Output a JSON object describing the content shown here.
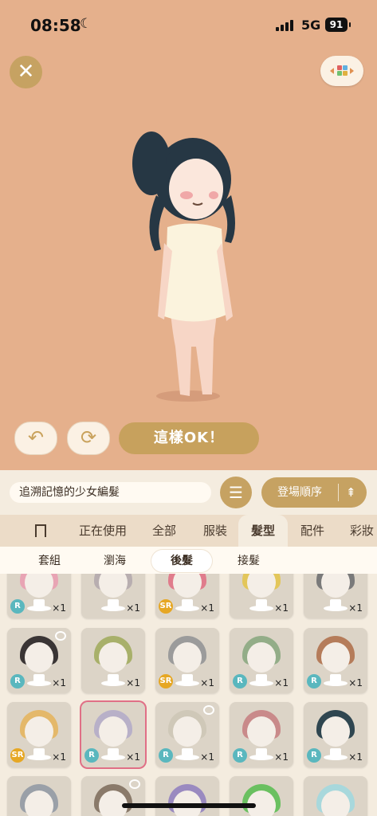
{
  "status": {
    "time": "08:58",
    "network": "5G",
    "battery": "91"
  },
  "toolbar": {
    "ok_label": "這樣OK！"
  },
  "item_name": "追溯記憶的少女編髮",
  "sort": {
    "label": "登場順序"
  },
  "tabs": [
    {
      "label": "正在使用"
    },
    {
      "label": "全部"
    },
    {
      "label": "服裝"
    },
    {
      "label": "髮型"
    },
    {
      "label": "配件"
    },
    {
      "label": "彩妝"
    }
  ],
  "subtabs": [
    {
      "label": "套組"
    },
    {
      "label": "瀏海"
    },
    {
      "label": "後髮"
    },
    {
      "label": "接髮"
    }
  ],
  "items": [
    {
      "rarity": "R",
      "count": "×1",
      "hair": "#e8a4b4"
    },
    {
      "rarity": "",
      "count": "×1",
      "hair": "#b8aeb0"
    },
    {
      "rarity": "SR",
      "count": "×1",
      "hair": "#e07c8c"
    },
    {
      "rarity": "",
      "count": "×1",
      "hair": "#e3c65a"
    },
    {
      "rarity": "",
      "count": "×1",
      "hair": "#7a7a7a"
    },
    {
      "rarity": "R",
      "count": "×1",
      "hair": "#3a3535"
    },
    {
      "rarity": "",
      "count": "×1",
      "hair": "#a8b06a"
    },
    {
      "rarity": "SR",
      "count": "×1",
      "hair": "#9b9b9b"
    },
    {
      "rarity": "R",
      "count": "×1",
      "hair": "#93ad88"
    },
    {
      "rarity": "R",
      "count": "×1",
      "hair": "#b57c5a"
    },
    {
      "rarity": "SR",
      "count": "×1",
      "hair": "#e4b86a"
    },
    {
      "rarity": "R",
      "count": "×1",
      "hair": "#b8b0c8"
    },
    {
      "rarity": "R",
      "count": "×1",
      "hair": "#cfc8b8"
    },
    {
      "rarity": "R",
      "count": "×1",
      "hair": "#c98a8a"
    },
    {
      "rarity": "R",
      "count": "×1",
      "hair": "#2f4650"
    },
    {
      "rarity": "",
      "count": "",
      "hair": "#9aa0a8"
    },
    {
      "rarity": "",
      "count": "",
      "hair": "#8a7a6a"
    },
    {
      "rarity": "",
      "count": "",
      "hair": "#9a8ac0"
    },
    {
      "rarity": "",
      "count": "",
      "hair": "#6ac060"
    },
    {
      "rarity": "",
      "count": "",
      "hair": "#a8d8dc"
    }
  ]
}
